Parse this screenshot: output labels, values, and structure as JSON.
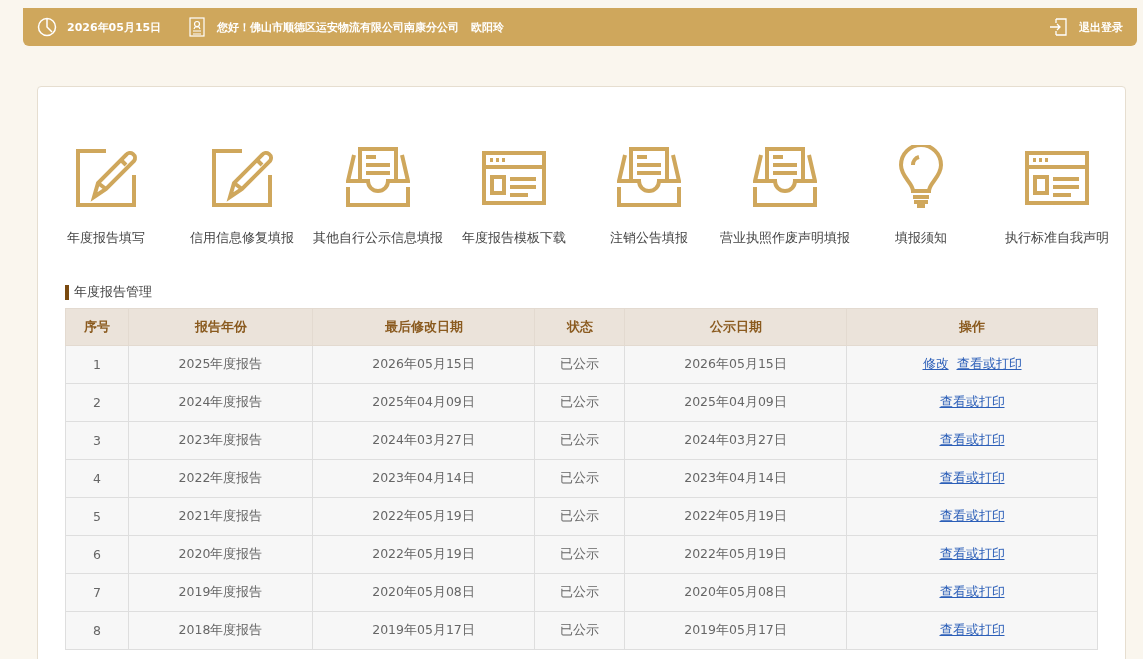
{
  "top_bar": {
    "date": "2026年05月15日",
    "greeting": "您好！佛山市顺德区运安物流有限公司南康分公司",
    "user_name": "欧阳玲",
    "logout": "退出登录"
  },
  "shortcuts": [
    {
      "label": "年度报告填写",
      "kind": "edit"
    },
    {
      "label": "信用信息修复填报",
      "kind": "edit"
    },
    {
      "label": "其他自行公示信息填报",
      "kind": "tray"
    },
    {
      "label": "年度报告模板下载",
      "kind": "window"
    },
    {
      "label": "注销公告填报",
      "kind": "tray"
    },
    {
      "label": "营业执照作废声明填报",
      "kind": "tray"
    },
    {
      "label": "填报须知",
      "kind": "bulb"
    },
    {
      "label": "执行标准自我声明",
      "kind": "window"
    }
  ],
  "section_title": "年度报告管理",
  "table": {
    "columns": [
      "序号",
      "报告年份",
      "最后修改日期",
      "状态",
      "公示日期",
      "操作"
    ],
    "rows": [
      {
        "cells": [
          "1",
          "2025年度报告",
          "2026年05月15日",
          "已公示",
          "2026年05月15日"
        ],
        "actions": [
          "修改",
          "查看或打印"
        ]
      },
      {
        "cells": [
          "2",
          "2024年度报告",
          "2025年04月09日",
          "已公示",
          "2025年04月09日"
        ],
        "actions": [
          "查看或打印"
        ]
      },
      {
        "cells": [
          "3",
          "2023年度报告",
          "2024年03月27日",
          "已公示",
          "2024年03月27日"
        ],
        "actions": [
          "查看或打印"
        ]
      },
      {
        "cells": [
          "4",
          "2022年度报告",
          "2023年04月14日",
          "已公示",
          "2023年04月14日"
        ],
        "actions": [
          "查看或打印"
        ]
      },
      {
        "cells": [
          "5",
          "2021年度报告",
          "2022年05月19日",
          "已公示",
          "2022年05月19日"
        ],
        "actions": [
          "查看或打印"
        ]
      },
      {
        "cells": [
          "6",
          "2020年度报告",
          "2022年05月19日",
          "已公示",
          "2022年05月19日"
        ],
        "actions": [
          "查看或打印"
        ]
      },
      {
        "cells": [
          "7",
          "2019年度报告",
          "2020年05月08日",
          "已公示",
          "2020年05月08日"
        ],
        "actions": [
          "查看或打印"
        ]
      },
      {
        "cells": [
          "8",
          "2018年度报告",
          "2019年05月17日",
          "已公示",
          "2019年05月17日"
        ],
        "actions": [
          "查看或打印"
        ]
      }
    ]
  }
}
